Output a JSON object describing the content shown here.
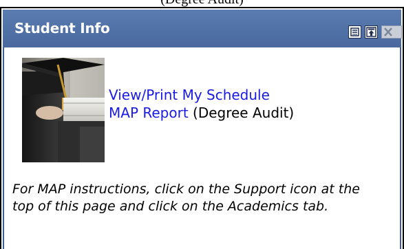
{
  "page": {
    "caption_fragment": "(Degree Audit)"
  },
  "portlet": {
    "title": "Student Info",
    "controls": {
      "restore_icon": "restore-icon",
      "maximize_icon": "maximize-icon",
      "close_icon": "close-icon"
    },
    "image": {
      "icon": "graduation-photo"
    },
    "links": {
      "schedule_label": "View/Print My Schedule",
      "map_report_label": "MAP Report",
      "map_report_suffix": " (Degree Audit)"
    },
    "instructions": "For MAP instructions, click on the Support icon at the top of this page and click on the Academics tab."
  },
  "colors": {
    "header_bg": "#4a6aa0",
    "header_text": "#ffffff",
    "link": "#1a1ae6",
    "body_bg": "#ffffff",
    "border": "#000000"
  }
}
